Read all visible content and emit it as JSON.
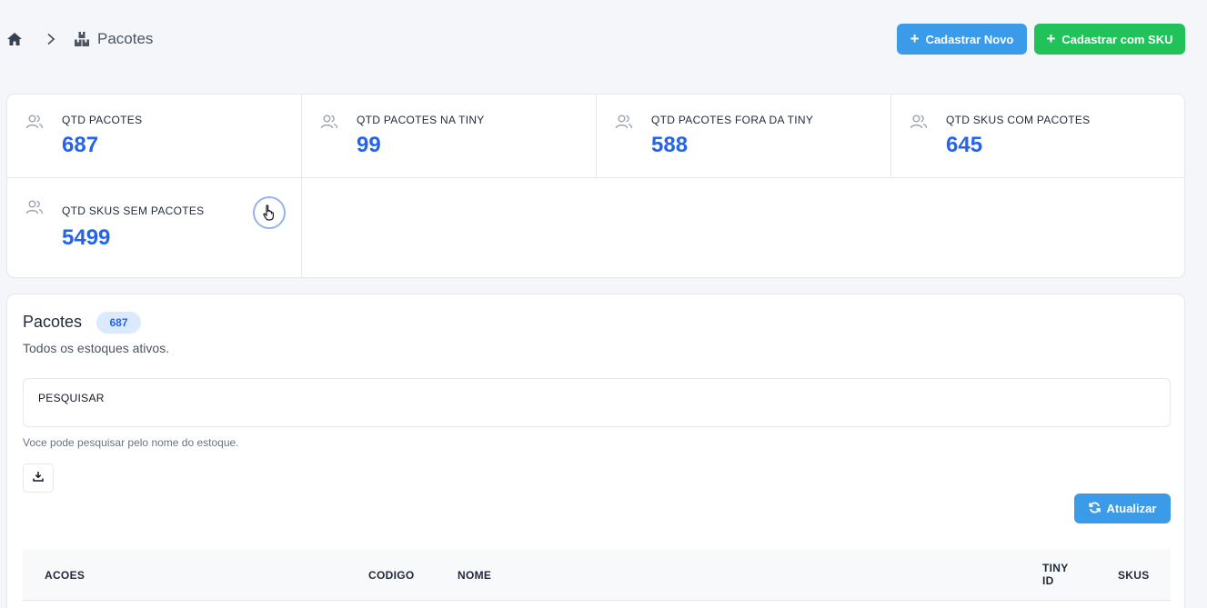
{
  "header": {
    "breadcrumb_label": "Pacotes",
    "btn_new": "Cadastrar Novo",
    "btn_sku": "Cadastrar com SKU"
  },
  "stats": [
    {
      "label": "QTD PACOTES",
      "value": "687",
      "icon": "users-icon"
    },
    {
      "label": "QTD PACOTES NA TINY",
      "value": "99",
      "icon": "users-icon"
    },
    {
      "label": "QTD PACOTES FORA DA TINY",
      "value": "588",
      "icon": "users-icon"
    },
    {
      "label": "QTD SKUS COM PACOTES",
      "value": "645",
      "icon": "users-icon"
    },
    {
      "label": "QTD SKUS SEM PACOTES",
      "value": "5499",
      "icon": "users-icon"
    }
  ],
  "main": {
    "title": "Pacotes",
    "count": "687",
    "subtitle": "Todos os estoques ativos.",
    "search_placeholder": "PESQUISAR",
    "search_hint": "Voce pode pesquisar pelo nome do estoque.",
    "refresh_label": "Atualizar"
  },
  "table": {
    "columns": [
      "ACOES",
      "CODIGO",
      "NOME",
      "TINY ID",
      "SKUS"
    ]
  },
  "colors": {
    "accent_blue": "#3b9be8",
    "accent_green": "#22c25a",
    "value_blue": "#2563eb"
  }
}
